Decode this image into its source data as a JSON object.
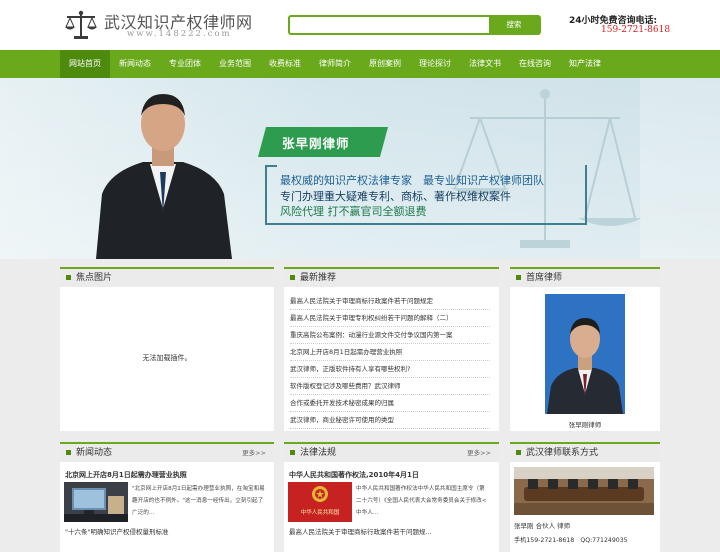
{
  "header": {
    "site_title": "武汉知识产权律师网",
    "site_url": "www.148222.com",
    "search_placeholder": "",
    "search_button": "搜索",
    "hotline_label": "24小时免费咨询电话:",
    "hotline_number": "159-2721-8618"
  },
  "nav": {
    "items": [
      "网站首页",
      "新闻动态",
      "专业团体",
      "业务范围",
      "收费标准",
      "律师简介",
      "原创案例",
      "理论探讨",
      "法律文书",
      "在线咨询",
      "知产法律"
    ],
    "active_index": 0
  },
  "banner": {
    "name": "张早刚律师",
    "lines": [
      "最权威的知识产权法律专家　最专业知识产权律师团队",
      "专门办理重大疑难专利、商标、著作权维权案件",
      "风险代理 打不赢官司全额退费"
    ]
  },
  "focus": {
    "title": "焦点图片",
    "empty_text": "无法加载插件。"
  },
  "recommend": {
    "title": "最新推荐",
    "items": [
      "最高人民法院关于审理商标行政案件若干问题规定",
      "最高人民法院关于审理专利权纠纷若干问题的解释（二）",
      "重庆高院公布案例：动漫行业源文件交付争议国内第一案",
      "北京网上开店8月1日起需办理营业执照",
      "武汉律师，正版软件持有人享有哪些权利?",
      "软件版权登记涉及哪些费用？武汉律师",
      "合作或委托开发技术秘密成果的归属",
      "武汉律师，商业秘密许可使用的类型"
    ]
  },
  "chief": {
    "title": "首席律师",
    "caption": "张早刚律师"
  },
  "news": {
    "title": "新闻动态",
    "more": "更多>>",
    "headline": "北京网上开店8月1日起需办理营业执照",
    "summary": "\"北京网上开店8月1日起需办理营业执照，在淘宝和易趣开店的也不例外。\"这一消息一经传出，立刻引起了广泛的...",
    "extra": "\"十六条\"明确知识产权侵权量刑标准"
  },
  "law": {
    "title": "法律法规",
    "more": "更多>>",
    "headline": "中华人民共和国著作权法,2010年4月1日",
    "thumb_caption": "中华人民共和国",
    "summary": "中华人民共和国著作权法中华人民共和国主席令（第二十六号）《全国人民代表大会常务委员会关于修改<中华人...",
    "extra": "最高人民法院关于审理商标行政案件若干问题规..."
  },
  "contact": {
    "title": "武汉律师联系方式",
    "person": "张早刚 合伙人 律师",
    "phone": "手机159-2721-8618　QQ:771249035"
  },
  "colors": {
    "brand_green": "#6aa91b",
    "nav_active": "#4e8a0e",
    "hotline_red": "#d42020",
    "name_plate": "#2d9c4f"
  }
}
